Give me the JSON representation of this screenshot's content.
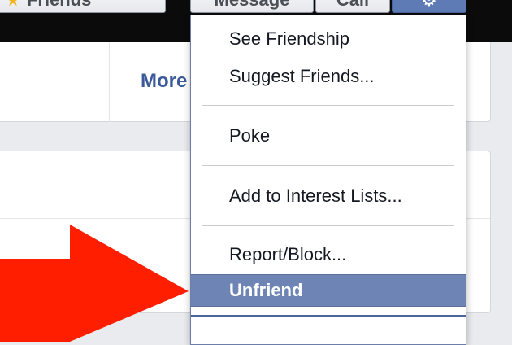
{
  "header": {
    "friends_label": "Friends",
    "message_label": "Message",
    "call_label": "Call",
    "friends_icon": "star-icon",
    "gear_icon": "gear-icon"
  },
  "nav": {
    "more_label": "More"
  },
  "menu": {
    "items": [
      {
        "label": "See Friendship"
      },
      {
        "label": "Suggest Friends..."
      },
      {
        "label": "Poke"
      },
      {
        "label": "Add to Interest Lists..."
      },
      {
        "label": "Report/Block..."
      },
      {
        "label": "Unfriend",
        "selected": true
      }
    ]
  },
  "annotation": {
    "arrow_color": "#ff1e00",
    "arrow_icon": "arrow-right-icon"
  },
  "colors": {
    "accent": "#6d84b4",
    "link": "#3b5998"
  }
}
